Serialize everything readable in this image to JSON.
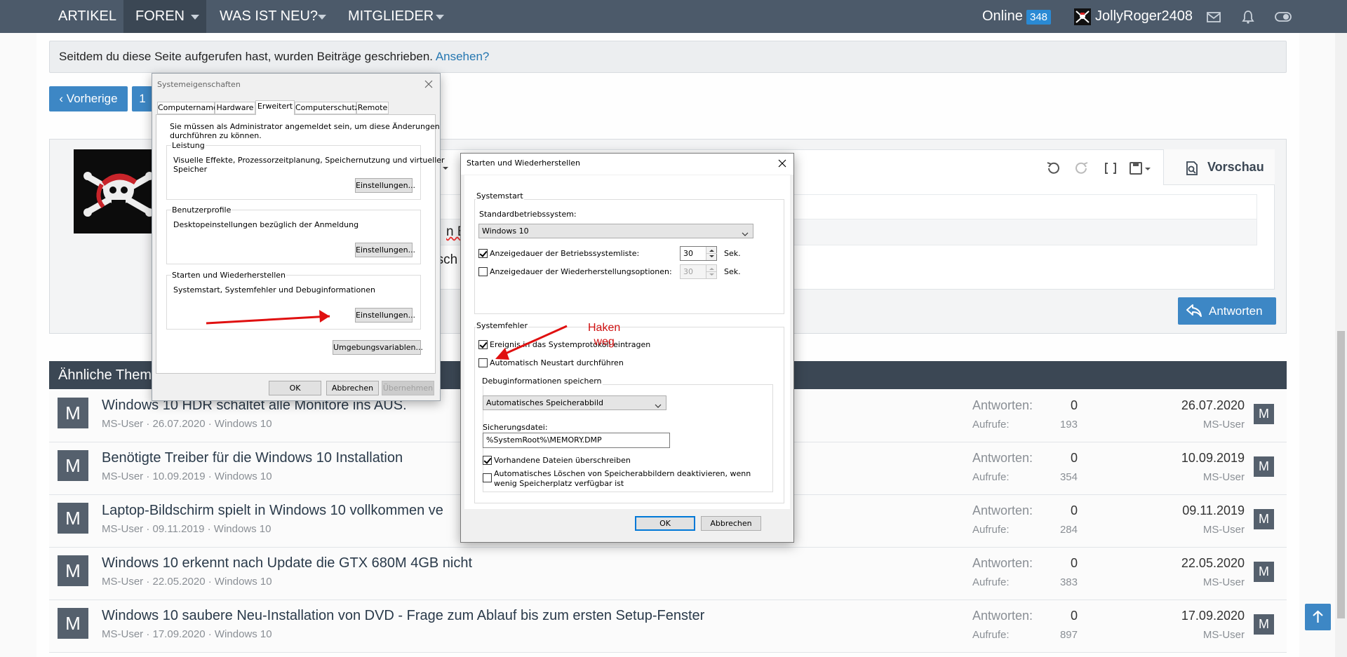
{
  "nav": {
    "items": [
      "ARTIKEL",
      "FOREN",
      "WAS IST NEU?",
      "MITGLIEDER"
    ],
    "online_label": "Online",
    "online_count": "348",
    "username": "JollyRoger2408"
  },
  "notice": {
    "text": "Seitdem du diese Seite aufgerufen hast, wurden Beiträge geschrieben.",
    "link": "Ansehen?"
  },
  "pager": {
    "prev": "Vorherige",
    "page": "1"
  },
  "editor": {
    "fragment_bs": "n BS",
    "fragment_usch": "usch",
    "preview": "Vorschau",
    "answer": "Antworten"
  },
  "similar": {
    "header": "Ähnliche Them",
    "answers_label": "Antworten:",
    "views_label": "Aufrufe:",
    "threads": [
      {
        "avatar": "M",
        "title": "Windows 10 HDR schaltet alle Monitore ins AUS.",
        "meta": "MS-User · 26.07.2020 · Windows 10",
        "answers": "0",
        "views": "193",
        "date": "26.07.2020",
        "user": "MS-User"
      },
      {
        "avatar": "M",
        "title": "Benötigte Treiber für die Windows 10 Installation",
        "meta": "MS-User · 10.09.2019 · Windows 10",
        "answers": "0",
        "views": "354",
        "date": "10.09.2019",
        "user": "MS-User"
      },
      {
        "avatar": "M",
        "title": "Laptop-Bildschirm spielt in Windows 10 vollkommen ve",
        "meta": "MS-User · 09.11.2019 · Windows 10",
        "answers": "0",
        "views": "284",
        "date": "09.11.2019",
        "user": "MS-User"
      },
      {
        "avatar": "M",
        "title": "Windows 10 erkennt nach Update die GTX 680M 4GB nicht",
        "meta": "MS-User · 22.05.2020 · Windows 10",
        "answers": "0",
        "views": "383",
        "date": "22.05.2020",
        "user": "MS-User"
      },
      {
        "avatar": "M",
        "title": "Windows 10 saubere Neu-Installation von DVD - Frage zum Ablauf bis zum ersten Setup-Fenster",
        "meta": "MS-User · 17.09.2020 · Windows 10",
        "answers": "0",
        "views": "897",
        "date": "17.09.2020",
        "user": "MS-User"
      }
    ]
  },
  "sysprops": {
    "title": "Systemeigenschaften",
    "tabs": [
      "Computername",
      "Hardware",
      "Erweitert",
      "Computerschutz",
      "Remote"
    ],
    "admin_note_1": "Sie müssen als Administrator angemeldet sein, um diese Änderungen",
    "admin_note_2": "durchführen zu können.",
    "perf_label": "Leistung",
    "perf_desc_1": "Visuelle Effekte, Prozessorzeitplanung, Speichernutzung und virtueller",
    "perf_desc_2": "Speicher",
    "profiles_label": "Benutzerprofile",
    "profiles_desc": "Desktopeinstellungen bezüglich der Anmeldung",
    "startup_label": "Starten und Wiederherstellen",
    "startup_desc": "Systemstart, Systemfehler und Debuginformationen",
    "settings_btn": "Einstellungen...",
    "env_btn": "Umgebungsvariablen...",
    "ok": "OK",
    "cancel": "Abbrechen",
    "apply": "Übernehmen"
  },
  "startup": {
    "title": "Starten und Wiederherstellen",
    "systemstart_label": "Systemstart",
    "default_os_label": "Standardbetriebssystem:",
    "default_os_value": "Windows 10",
    "show_list_label": "Anzeigedauer der Betriebssystemliste:",
    "show_list_value": "30",
    "show_recovery_label": "Anzeigedauer der Wiederherstellungsoptionen:",
    "show_recovery_value": "30",
    "sec": "Sek.",
    "systemfehler_label": "Systemfehler",
    "write_event": "Ereignis in das Systemprotokoll eintragen",
    "auto_restart": "Automatisch Neustart durchführen",
    "debug_label": "Debuginformationen speichern",
    "dump_type": "Automatisches Speicherabbild",
    "dump_file_label": "Sicherungsdatei:",
    "dump_file_value": "%SystemRoot%\\MEMORY.DMP",
    "overwrite": "Vorhandene Dateien überschreiben",
    "disable_autodelete_1": "Automatisches Löschen von Speicherabbildern deaktivieren, wenn",
    "disable_autodelete_2": "wenig Speicherplatz verfügbar ist",
    "ok": "OK",
    "cancel": "Abbrechen"
  },
  "annotation": {
    "line1": "Haken",
    "line2": "weg",
    "color": "#e01010"
  }
}
